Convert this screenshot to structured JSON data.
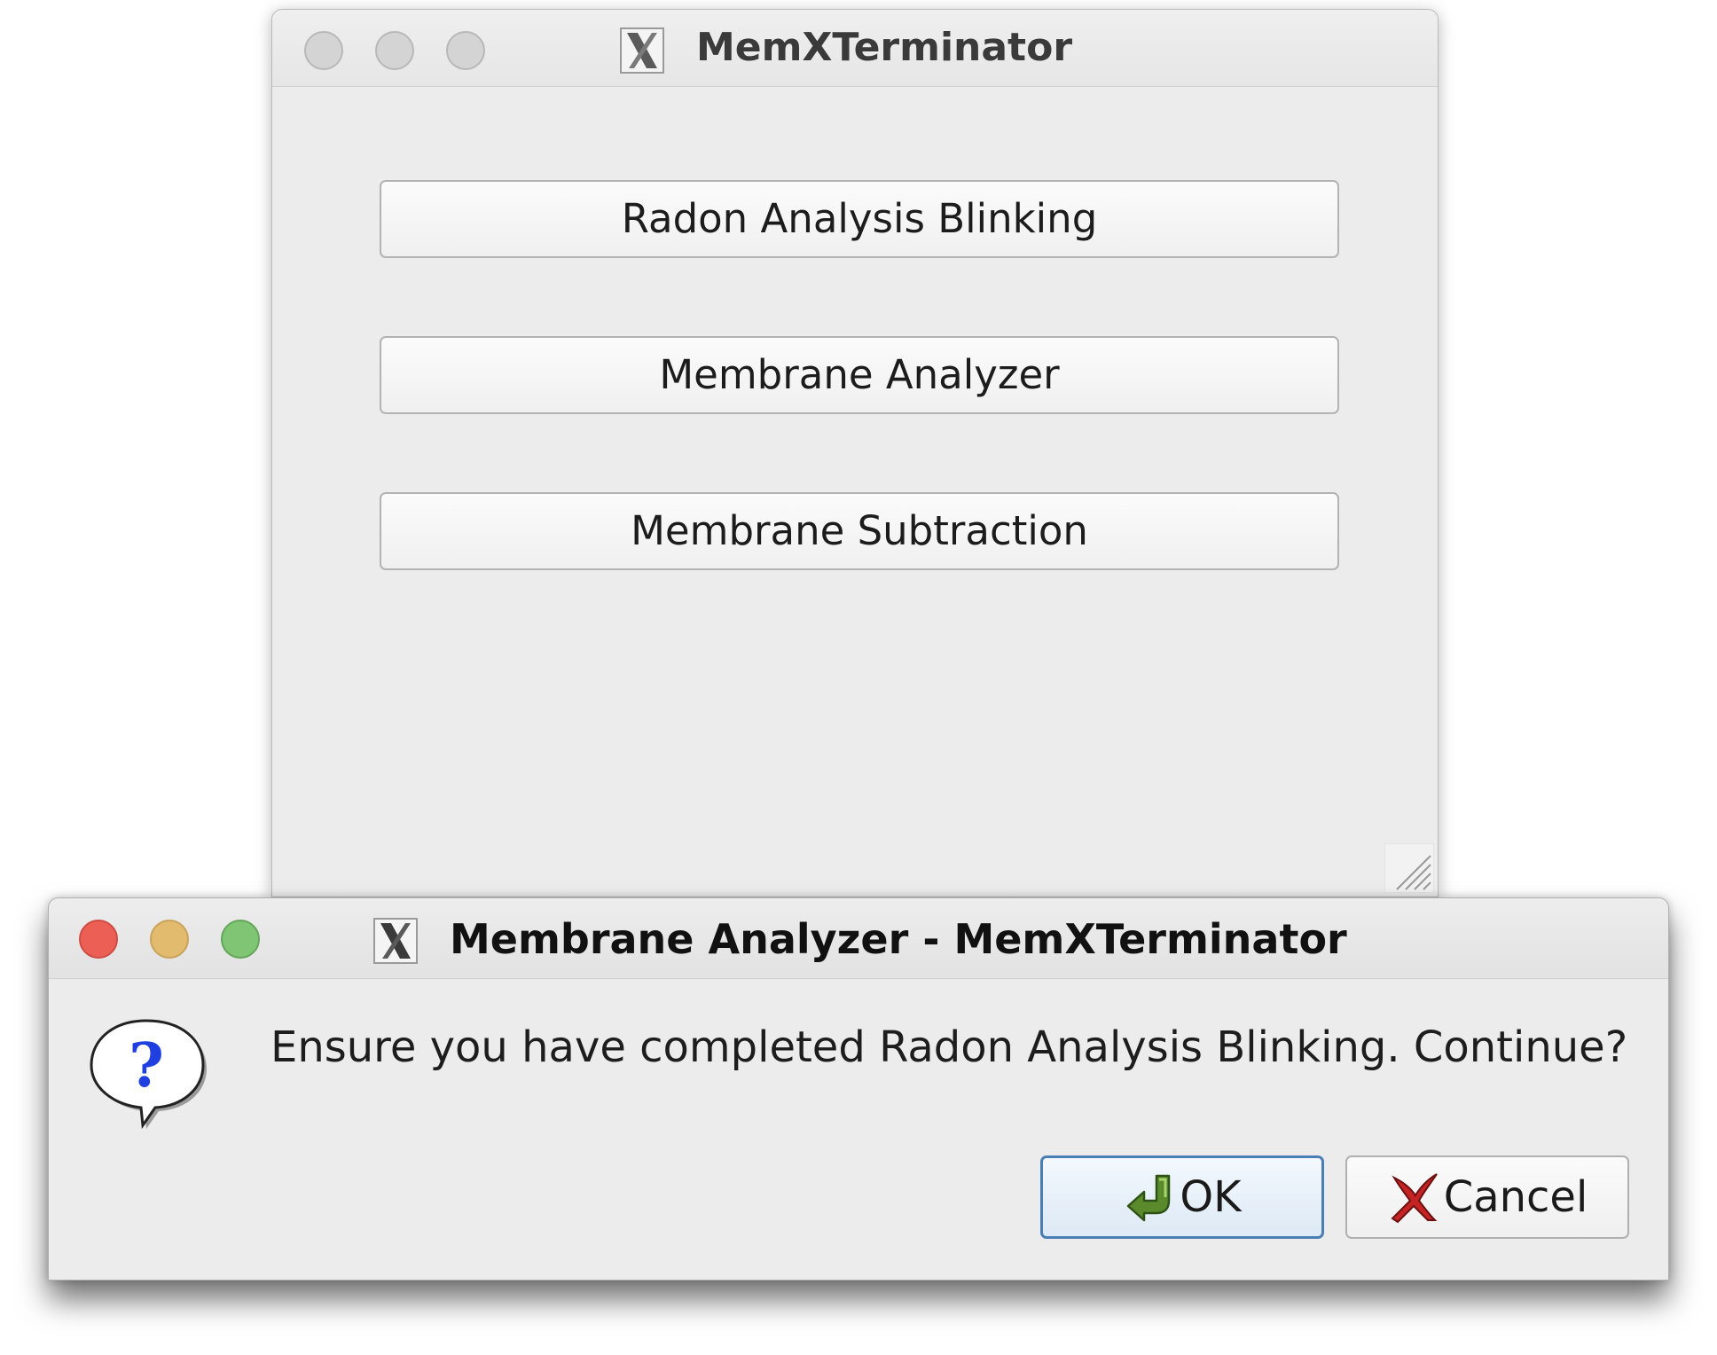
{
  "main_window": {
    "title": "MemXTerminator",
    "buttons": [
      "Radon Analysis Blinking",
      "Membrane Analyzer",
      "Membrane Subtraction"
    ]
  },
  "dialog": {
    "title": "Membrane Analyzer - MemXTerminator",
    "message": "Ensure you have completed Radon Analysis Blinking. Continue?",
    "ok_label": "OK",
    "cancel_label": "Cancel"
  },
  "icons": {
    "app": "x11-app-icon",
    "dialog": "question-icon",
    "ok": "green-return-arrow-icon",
    "cancel": "red-x-icon",
    "grip": "resize-grip-icon"
  },
  "colors": {
    "close": "#ec5f55",
    "minimize": "#e2bb6f",
    "maximize": "#80c574",
    "ok_border": "#4a7fb5",
    "question_mark": "#1f3fe0"
  }
}
